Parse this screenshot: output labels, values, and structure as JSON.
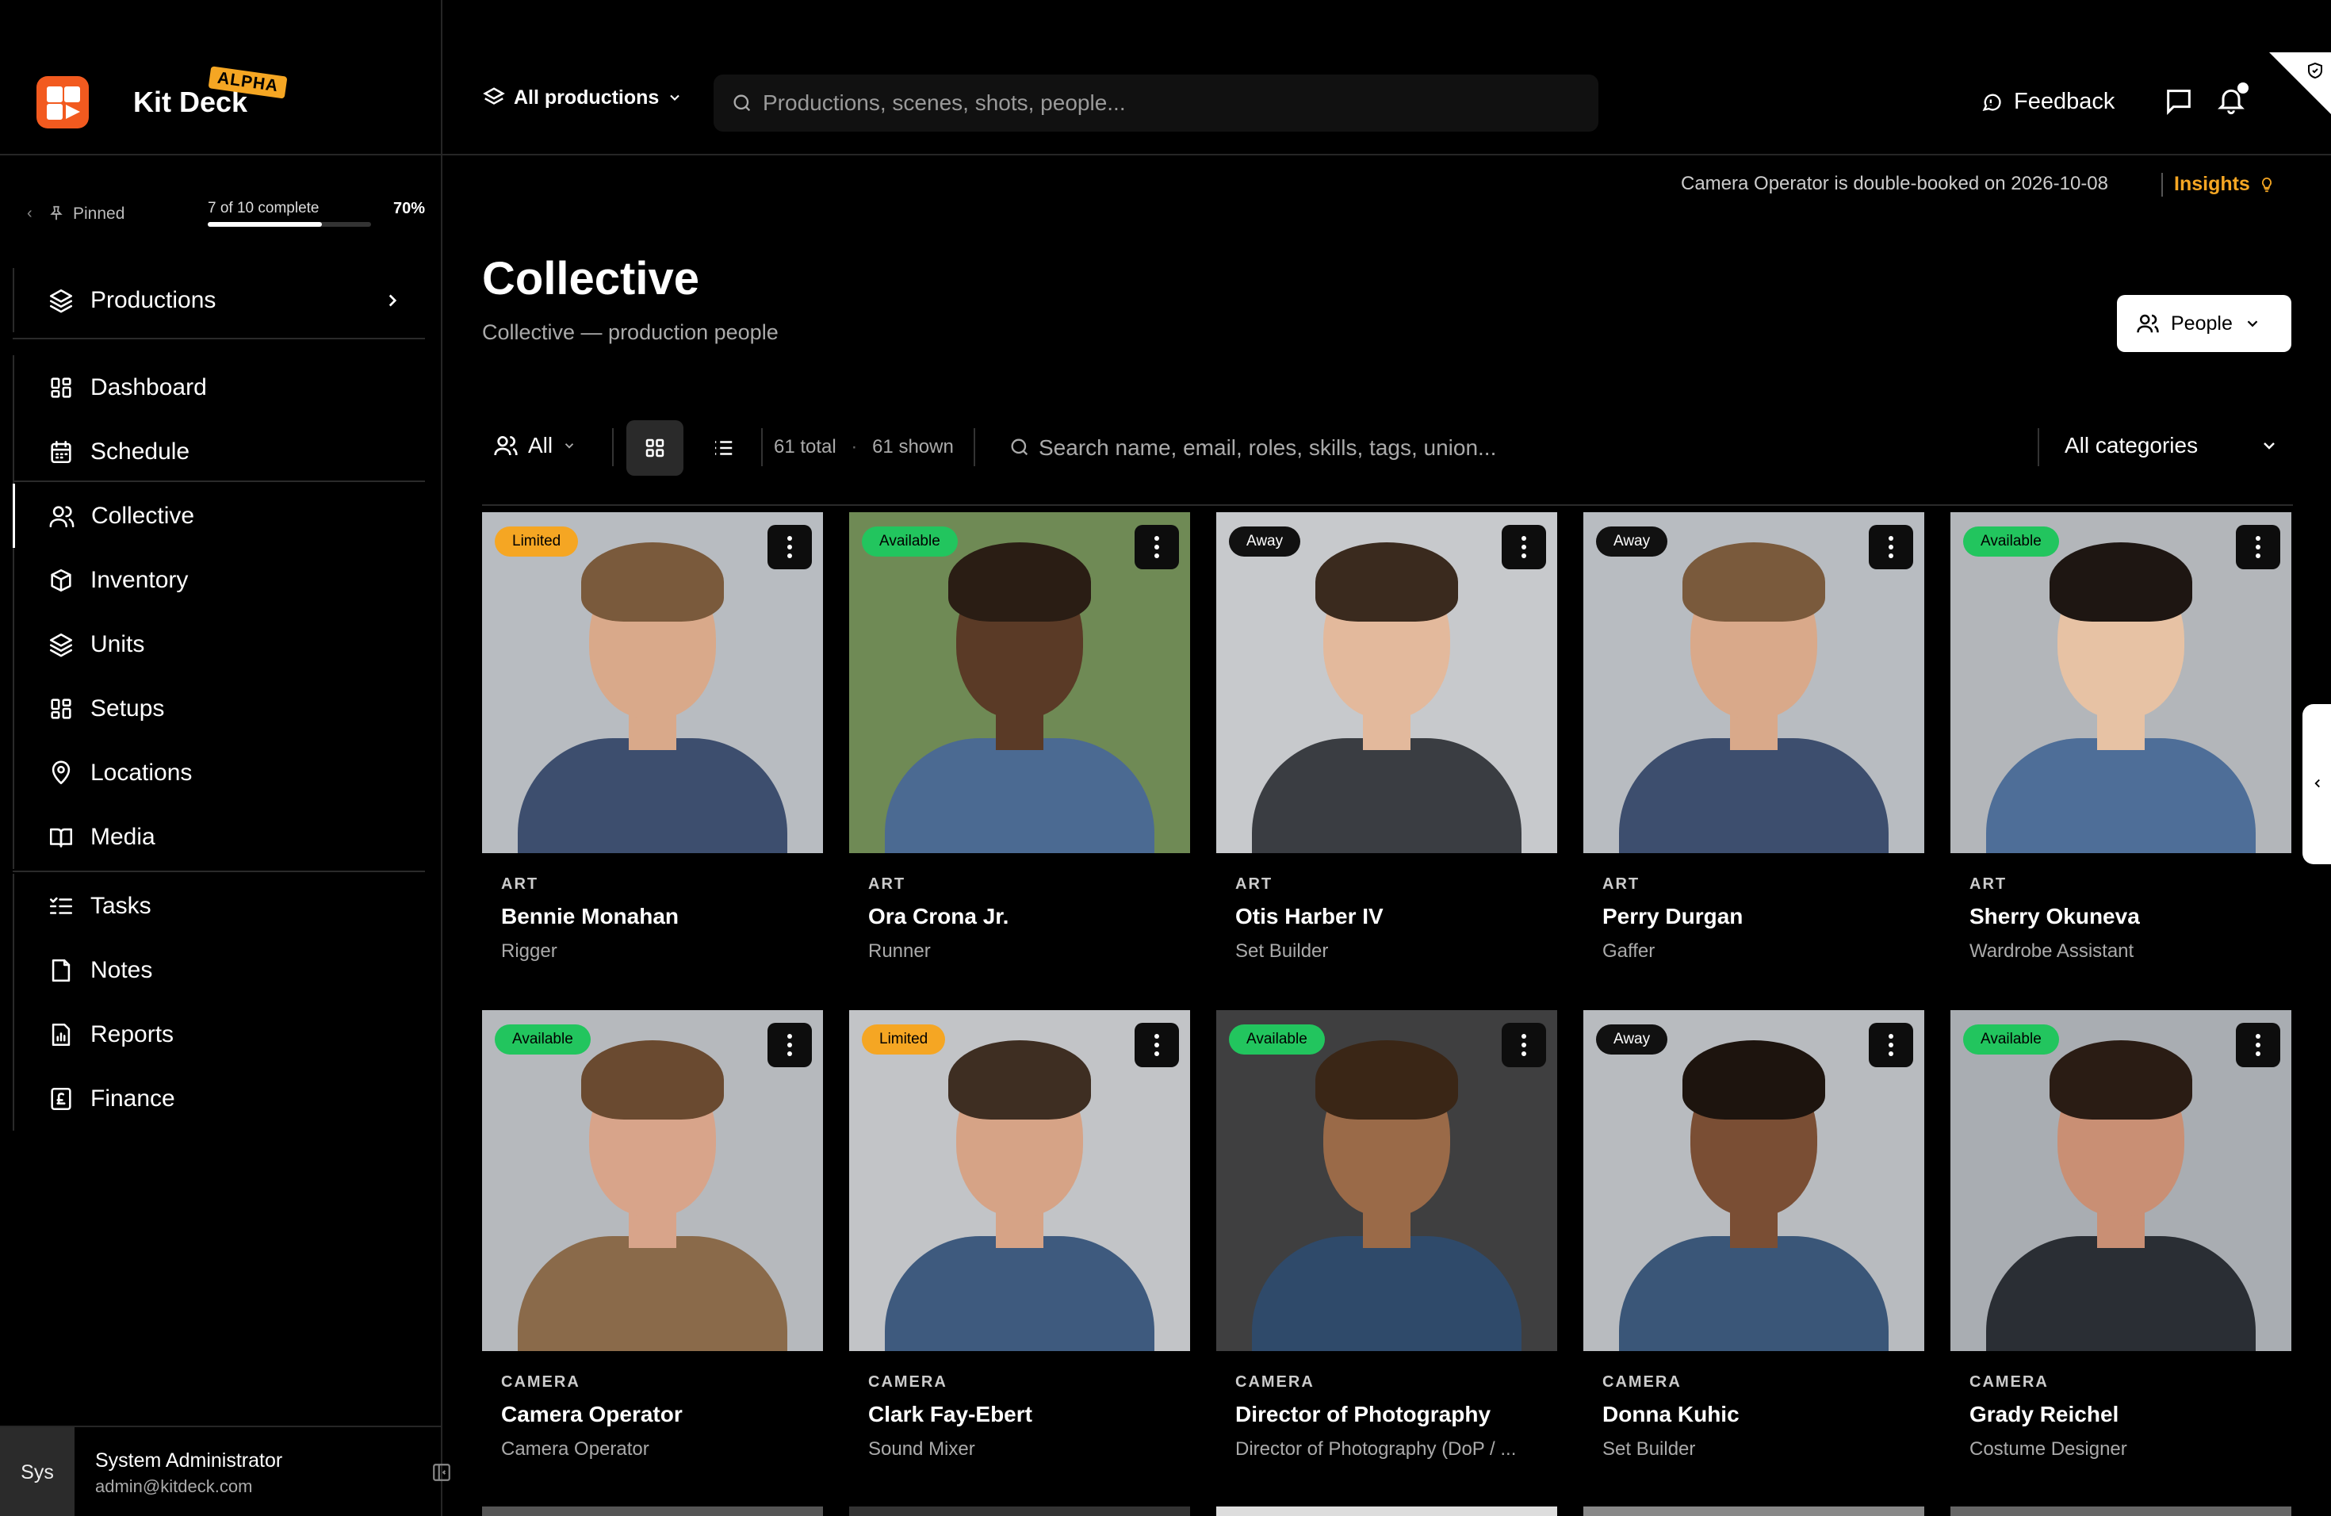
{
  "app": {
    "name": "Kit Deck",
    "badge": "ALPHA"
  },
  "sidebar": {
    "pinned_label": "Pinned",
    "progress": {
      "text": "7 of 10 complete",
      "percent_label": "70%",
      "fraction": 0.7
    },
    "groups": [
      [
        {
          "label": "Productions",
          "icon": "layers-icon"
        }
      ],
      [
        {
          "label": "Dashboard",
          "icon": "dashboard-icon"
        },
        {
          "label": "Schedule",
          "icon": "calendar-icon"
        }
      ],
      [
        {
          "label": "Collective",
          "icon": "users-icon"
        },
        {
          "label": "Inventory",
          "icon": "box-icon"
        },
        {
          "label": "Units",
          "icon": "layers-icon"
        },
        {
          "label": "Setups",
          "icon": "dashboard-icon"
        },
        {
          "label": "Locations",
          "icon": "pin-icon"
        },
        {
          "label": "Media",
          "icon": "book-icon"
        }
      ],
      [
        {
          "label": "Tasks",
          "icon": "list-check-icon"
        },
        {
          "label": "Notes",
          "icon": "note-icon"
        },
        {
          "label": "Reports",
          "icon": "report-icon"
        },
        {
          "label": "Finance",
          "icon": "finance-icon"
        }
      ]
    ],
    "user": {
      "avatar_text": "Sys",
      "name": "System Administrator",
      "email": "admin@kitdeck.com"
    }
  },
  "topbar": {
    "production_switch": "All productions",
    "search_placeholder": "Productions, scenes, shots, people...",
    "feedback_label": "Feedback"
  },
  "alert": {
    "text": "Camera Operator is double-booked on 2026-10-08",
    "insights_label": "Insights"
  },
  "page": {
    "title": "Collective",
    "subtitle": "Collective — production people",
    "people_button": "People"
  },
  "toolbar": {
    "filter_label": "All",
    "total_label": "61 total",
    "shown_label": "61 shown",
    "separator": "·",
    "search_placeholder": "Search name, email, roles, skills, tags, union...",
    "category_value": "All categories"
  },
  "colors": {
    "available": "#22c55e",
    "limited": "#f5a623",
    "away": "#111111",
    "brand": "#f25a1f"
  },
  "cards": [
    {
      "status": "Limited",
      "dept": "ART",
      "name": "Bennie Monahan",
      "role": "Rigger",
      "bg": "#b8bcc1",
      "skin": "#d9a98a",
      "hair": "#7a5a3c",
      "shirt": "#3d4e6e"
    },
    {
      "status": "Available",
      "dept": "ART",
      "name": "Ora Crona Jr.",
      "role": "Runner",
      "bg": "#6f8a55",
      "skin": "#5a3a26",
      "hair": "#2a1d14",
      "shirt": "#4b6a92"
    },
    {
      "status": "Away",
      "dept": "ART",
      "name": "Otis Harber IV",
      "role": "Set Builder",
      "bg": "#c7c9cc",
      "skin": "#e3b99c",
      "hair": "#3a2a1e",
      "shirt": "#3a3d42"
    },
    {
      "status": "Away",
      "dept": "ART",
      "name": "Perry Durgan",
      "role": "Gaffer",
      "bg": "#b8bcc1",
      "skin": "#d9a98a",
      "hair": "#7a5a3c",
      "shirt": "#3d4e6e"
    },
    {
      "status": "Available",
      "dept": "ART",
      "name": "Sherry Okuneva",
      "role": "Wardrobe Assistant",
      "bg": "#b3b6ba",
      "skin": "#e7c2a4",
      "hair": "#1e1612",
      "shirt": "#4e6e98"
    },
    {
      "status": "Available",
      "dept": "CAMERA",
      "name": "Camera Operator",
      "role": "Camera Operator",
      "bg": "#b6b9bd",
      "skin": "#d8a48a",
      "hair": "#6a4a30",
      "shirt": "#8a6a4a"
    },
    {
      "status": "Limited",
      "dept": "CAMERA",
      "name": "Clark Fay-Ebert",
      "role": "Sound Mixer",
      "bg": "#c2c4c7",
      "skin": "#d6a386",
      "hair": "#3e2e22",
      "shirt": "#3e5a7e"
    },
    {
      "status": "Available",
      "dept": "CAMERA",
      "name": "Director of Photography",
      "role": "Director of Photography (DoP / ...",
      "bg": "#3f3f40",
      "skin": "#9a6a48",
      "hair": "#3a2616",
      "shirt": "#2f4a6a"
    },
    {
      "status": "Away",
      "dept": "CAMERA",
      "name": "Donna Kuhic",
      "role": "Set Builder",
      "bg": "#b8bbbf",
      "skin": "#7a4e34",
      "hair": "#1d140e",
      "shirt": "#3a5678"
    },
    {
      "status": "Available",
      "dept": "CAMERA",
      "name": "Grady Reichel",
      "role": "Costume Designer",
      "bg": "#a9adb2",
      "skin": "#c98f74",
      "hair": "#2a1c14",
      "shirt": "#2a2e34"
    }
  ]
}
